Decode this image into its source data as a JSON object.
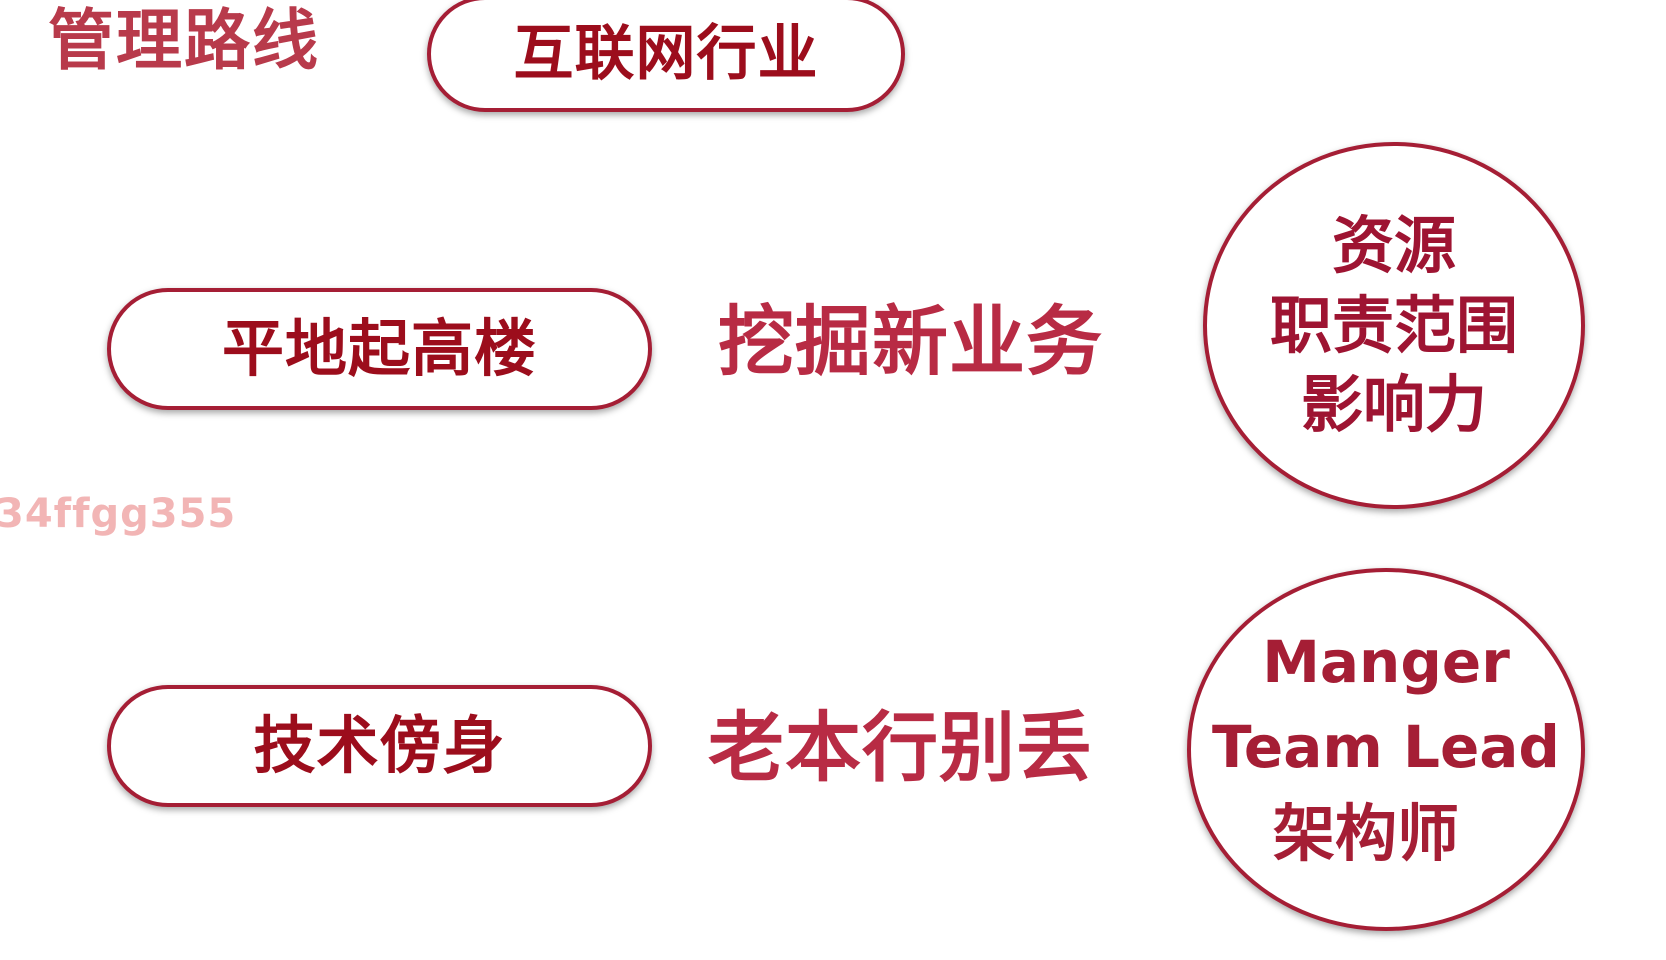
{
  "slide": {
    "title": "管理路线",
    "industry_tag": "互联网行业"
  },
  "rows": [
    {
      "pill_label": "平地起高楼",
      "middle_text": "挖掘新业务",
      "circle_lines": [
        "资源",
        "职责范围",
        "影响力"
      ]
    },
    {
      "pill_label": "技术傍身",
      "middle_text": "老本行别丢",
      "circle_lines": [
        "Manger",
        "Team Lead",
        "架构师"
      ]
    }
  ],
  "watermark": "34ffgg355",
  "colors": {
    "title": "#b83a4b",
    "border": "#a51e35",
    "pill_text": "#9c0d1c",
    "middle_text": "#b82b44",
    "watermark": "#e87878",
    "background": "#ffffff"
  }
}
